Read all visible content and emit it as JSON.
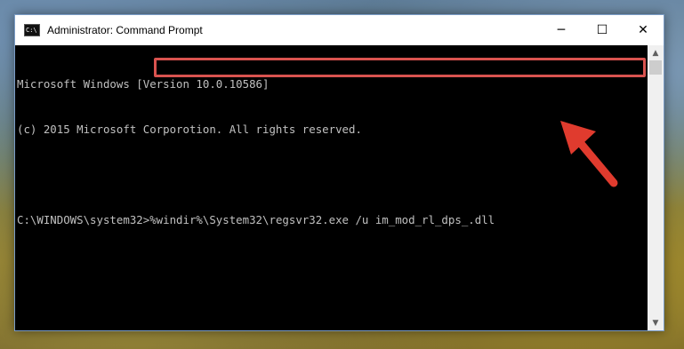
{
  "window": {
    "title": "Administrator: Command Prompt",
    "icon_label": "C:\\",
    "controls": {
      "minimize": "─",
      "maximize": "☐",
      "close": "✕"
    }
  },
  "console": {
    "lines": [
      "Microsoft Windows [Version 10.0.10586]",
      "(c) 2015 Microsoft Corporotion. All rights reserved.",
      ""
    ],
    "prompt": "C:\\WINDOWS\\system32>",
    "command": "%windir%\\System32\\regsvr32.exe /u im_mod_rl_dps_.dll"
  },
  "colors": {
    "highlight": "#d9534f",
    "console_bg": "#000000",
    "console_text": "#c0c0c0"
  },
  "icons": {
    "app": "cmd-icon",
    "scroll_up": "chevron-up-icon",
    "scroll_down": "chevron-down-icon",
    "annotation": "red-arrow-icon"
  }
}
